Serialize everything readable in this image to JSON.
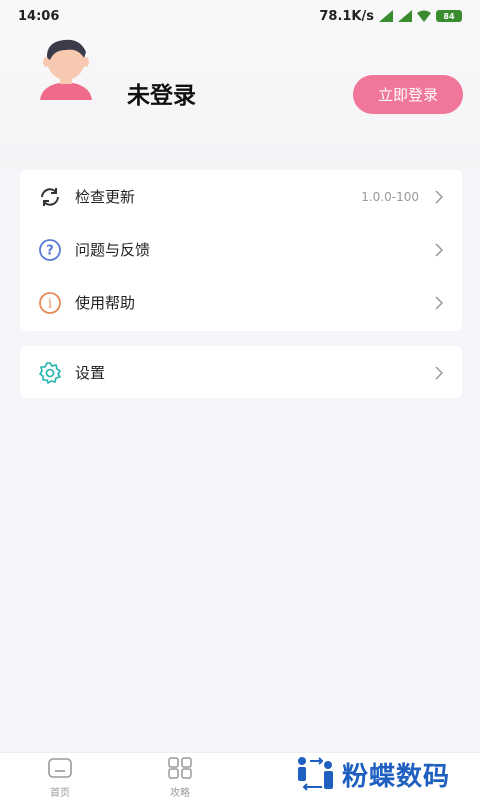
{
  "status_bar": {
    "time": "14:06",
    "network_speed": "78.1K/s",
    "battery": "84"
  },
  "profile": {
    "username": "未登录",
    "login_button": "立即登录"
  },
  "menu": {
    "check_update": {
      "label": "检查更新",
      "value": "1.0.0-100",
      "icon": "refresh-icon"
    },
    "feedback": {
      "label": "问题与反馈",
      "icon": "question-icon"
    },
    "help": {
      "label": "使用帮助",
      "icon": "info-icon"
    },
    "settings": {
      "label": "设置",
      "icon": "gear-icon"
    }
  },
  "bottom_nav": {
    "home": "首页",
    "guide": "攻略"
  },
  "watermark": "粉蝶数码",
  "colors": {
    "accent": "#f0769a",
    "settings_icon": "#20b2aa",
    "info_icon": "#e58a55",
    "question_icon": "#5b7bd5",
    "watermark": "#1f5fbf"
  }
}
